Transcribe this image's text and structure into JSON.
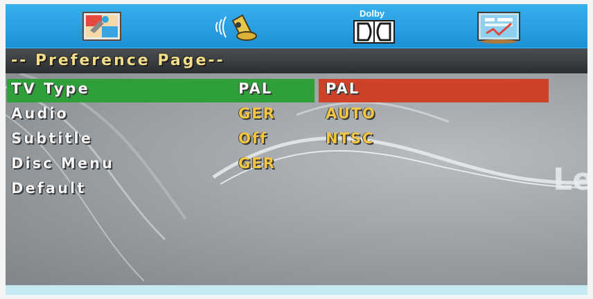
{
  "tabs": [
    {
      "name": "general-setup",
      "icon": "settings-picture-icon"
    },
    {
      "name": "audio-setup",
      "icon": "speaker-icon"
    },
    {
      "name": "dolby-setup",
      "icon": "dolby-logo-icon",
      "label": "Dolby"
    },
    {
      "name": "preference-setup",
      "icon": "preference-chart-icon"
    }
  ],
  "header": {
    "title": "-- Preference Page--"
  },
  "rows": [
    {
      "label": "TV Type",
      "value": "PAL",
      "selected": true
    },
    {
      "label": "Audio",
      "value": "GER"
    },
    {
      "label": "Subtitle",
      "value": "Off"
    },
    {
      "label": "Disc Menu",
      "value": "GER"
    },
    {
      "label": "Default",
      "value": ""
    }
  ],
  "options": [
    "PAL",
    "AUTO",
    "NTSC"
  ],
  "watermark": "Le",
  "colors": {
    "topbar": "#1e90d6",
    "header_text": "#f1dd8a",
    "selected_row": "#2f9f3a",
    "option_highlight": "#d0412a",
    "value_text": "#f5c640"
  }
}
